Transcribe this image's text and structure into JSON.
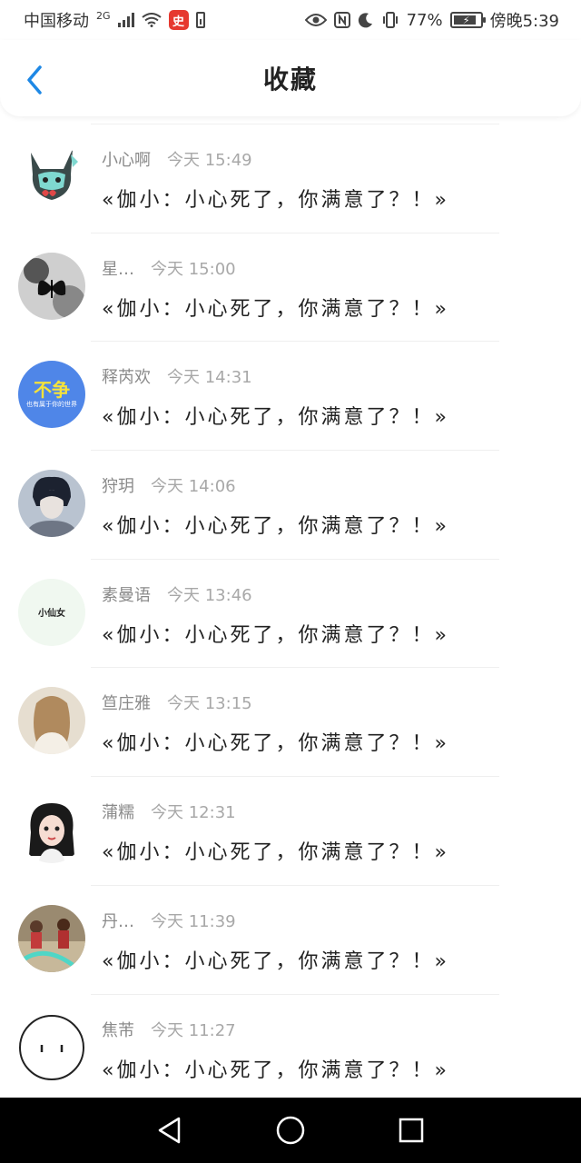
{
  "status_bar": {
    "carrier": "中国移动",
    "network": "2G",
    "badge_text": "史",
    "battery_percent": "77%",
    "time": "傍晚5:39"
  },
  "header": {
    "title": "收藏"
  },
  "messages": [
    {
      "nick": "小心啊",
      "time": "今天 15:49",
      "text": "«伽小：小心死了，你满意了？！»",
      "avatar": "cat-green",
      "avatar_icon": "cat-avatar"
    },
    {
      "nick": "星…",
      "time": "今天 15:00",
      "text": "«伽小：小心死了，你满意了？！»",
      "avatar": "butterfly",
      "avatar_icon": "butterfly-avatar"
    },
    {
      "nick": "释芮欢",
      "time": "今天 14:31",
      "text": "«伽小：小心死了，你满意了？！»",
      "avatar": "text-blue",
      "avatar_icon": "text-avatar",
      "avatar_text_big": "不争",
      "avatar_text_small": "也有属于你的世界"
    },
    {
      "nick": "狩玥",
      "time": "今天 14:06",
      "text": "«伽小：小心死了，你满意了？！»",
      "avatar": "boy",
      "avatar_icon": "boy-avatar"
    },
    {
      "nick": "素曼语",
      "time": "今天 13:46",
      "text": "«伽小：小心死了，你满意了？！»",
      "avatar": "text-light",
      "avatar_icon": "text-avatar",
      "avatar_text_small": "小仙女"
    },
    {
      "nick": "笪庄雅",
      "time": "今天 13:15",
      "text": "«伽小：小心死了，你满意了？！»",
      "avatar": "girl-back",
      "avatar_icon": "girl-avatar"
    },
    {
      "nick": "蒲糯",
      "time": "今天 12:31",
      "text": "«伽小：小心死了，你满意了？！»",
      "avatar": "girl-face",
      "avatar_icon": "girl-avatar"
    },
    {
      "nick": "丹…",
      "time": "今天 11:39",
      "text": "«伽小：小心死了，你满意了？！»",
      "avatar": "group-photo",
      "avatar_icon": "photo-avatar"
    },
    {
      "nick": "焦芾",
      "time": "今天 11:27",
      "text": "«伽小：小心死了，你满意了？！»",
      "avatar": "face-outline",
      "avatar_icon": "face-avatar"
    }
  ],
  "nav_bar": {
    "back": "back-triangle-icon",
    "home": "home-circle-icon",
    "recent": "recent-square-icon"
  },
  "colors": {
    "accent": "#1e88e5",
    "divider": "#efefef",
    "nav_bg": "#000000"
  }
}
